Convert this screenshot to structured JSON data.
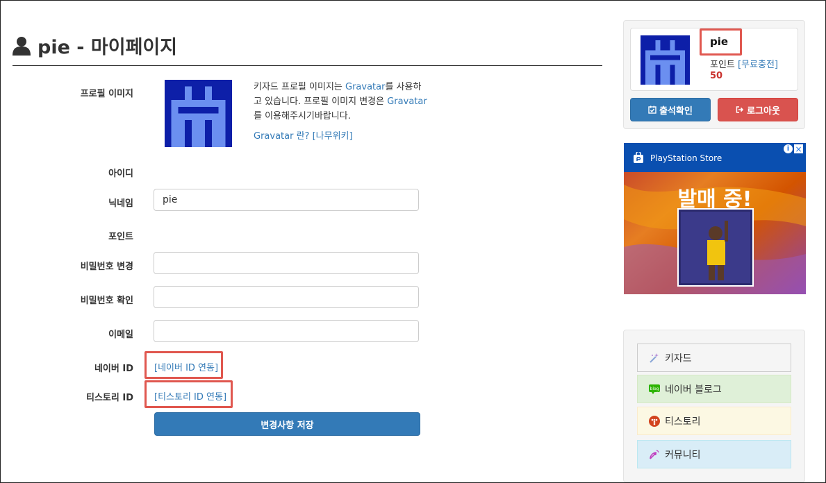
{
  "page": {
    "title": "pie - 마이페이지"
  },
  "form": {
    "profile_image_label": "프로필 이미지",
    "profile_text_1": "키자드 프로필 이미지는 ",
    "gravatar_link_1": "Gravatar",
    "profile_text_2": "를 사용하고 있습니다. 프로필 이미지 변경은 ",
    "gravatar_link_2": "Gravatar",
    "profile_text_3": "를 이용해주시기바랍니다.",
    "gravatar_help": "Gravatar 란? [나무위키]",
    "id_label": "아이디",
    "nickname_label": "닉네임",
    "nickname_value": "pie",
    "points_label": "포인트",
    "password_change_label": "비밀번호 변경",
    "password_confirm_label": "비밀번호 확인",
    "email_label": "이메일",
    "naver_label": "네이버 ID",
    "naver_link": "[네이버 ID 연동]",
    "tistory_label": "티스토리 ID",
    "tistory_link": "[티스토리 ID 연동]",
    "save_label": "변경사항 저장"
  },
  "sidebar": {
    "username": "pie",
    "points_label": "포인트 ",
    "free_charge": "[무료충전]",
    "points_value": "50",
    "attendance_label": "출석확인",
    "logout_label": "로그아웃",
    "ad": {
      "store": "PlayStation Store",
      "headline": "발매 중!"
    },
    "menu": [
      {
        "label": "키자드",
        "icon": "wand-icon"
      },
      {
        "label": "네이버 블로그",
        "icon": "blog-icon"
      },
      {
        "label": "티스토리",
        "icon": "tistory-icon"
      },
      {
        "label": "커뮤니티",
        "icon": "satellite-icon"
      }
    ]
  },
  "colors": {
    "primary": "#337ab7",
    "danger": "#d9534f",
    "highlight": "#e0574f",
    "avatar_bg": "#0d1fa8",
    "avatar_fg": "#6b8ff0"
  }
}
